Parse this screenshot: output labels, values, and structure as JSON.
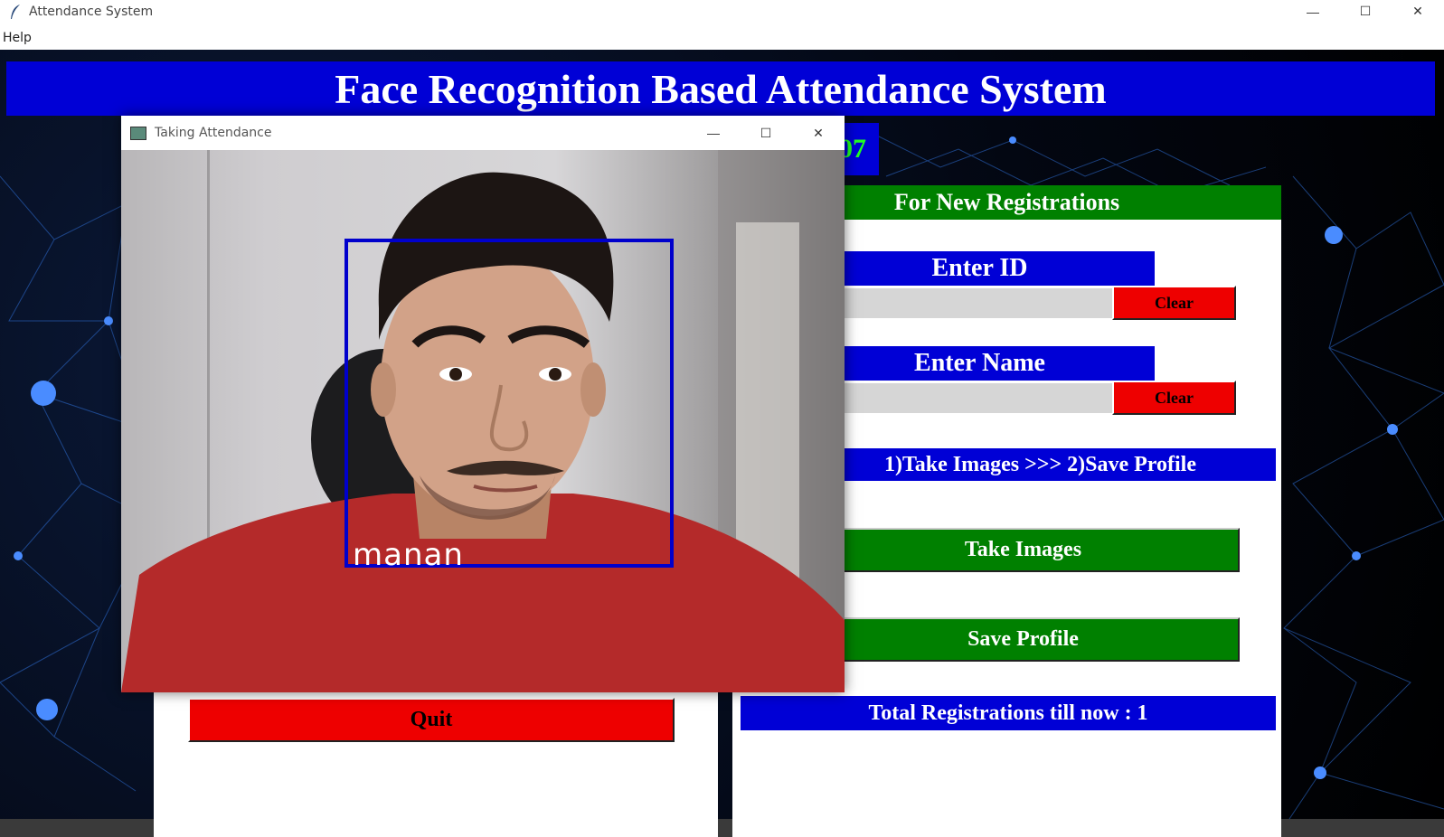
{
  "window": {
    "title": "Attendance System",
    "controls": [
      "—",
      "☐",
      "✕"
    ]
  },
  "menu": {
    "help": "Help"
  },
  "header": {
    "title": "Face Recognition Based Attendance System",
    "date_fragment": "07"
  },
  "registration": {
    "heading": "For New Registrations",
    "id_label": "Enter ID",
    "id_value": "",
    "id_clear": "Clear",
    "name_label": "Enter Name",
    "name_value": "",
    "name_clear": "Clear",
    "steps": "1)Take Images  >>>  2)Save Profile",
    "take_images": "Take Images",
    "save_profile": "Save Profile",
    "total": "Total Registrations till now  : 1"
  },
  "attendance": {
    "quit": "Quit"
  },
  "popup": {
    "title": "Taking Attendance",
    "controls": [
      "—",
      "☐",
      "✕"
    ],
    "recognized_name": "manan"
  },
  "colors": {
    "header_blue": "#0000d6",
    "heading_green": "#008000",
    "button_red": "#ee0000",
    "date_green": "#22ff22",
    "face_box": "#0000cc"
  }
}
